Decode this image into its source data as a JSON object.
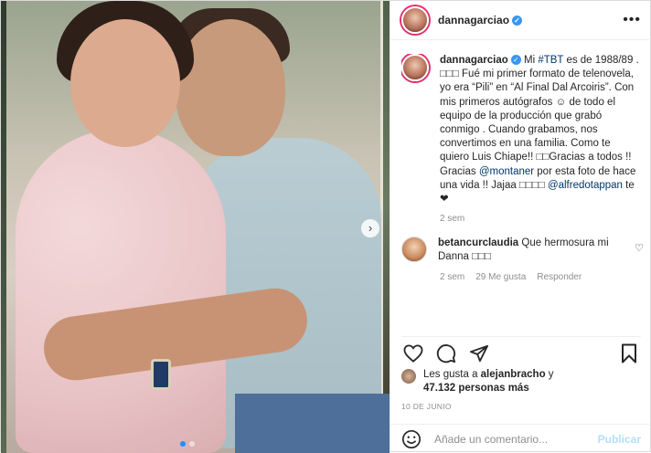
{
  "post": {
    "media": {
      "image_alt": "Foto antigua: niña abrazando a un hombre",
      "carousel_dots": 2,
      "active_dot": 0
    },
    "header": {
      "username": "dannagarciao",
      "more_glyph": "•••"
    },
    "caption": {
      "username": "dannagarciao",
      "parts": [
        {
          "type": "text",
          "value": "Mi "
        },
        {
          "type": "link",
          "value": "#TBT"
        },
        {
          "type": "text",
          "value": " es de 1988/89 . □□□ Fué mi primer formato de telenovela, yo era “Pili” en “Al Final Dal Arcoiris”. Con mis primeros autógrafos ☺ de todo el equipo de la producción que grabó conmigo . Cuando grabamos, nos convertimos en una familia. Como te quiero Luis Chiape!! □□Gracias a todos !! Gracias "
        },
        {
          "type": "link",
          "value": "@montaner"
        },
        {
          "type": "text",
          "value": " por esta foto de hace una vida !! Jajaa □□□□ "
        },
        {
          "type": "link",
          "value": "@alfredotappan"
        },
        {
          "type": "text",
          "value": " te❤"
        }
      ],
      "time": "2 sem"
    },
    "comment": {
      "username": "betancurclaudia",
      "text": "Que hermosura mi Danna □□□",
      "time": "2 sem",
      "likes": "29 Me gusta",
      "reply": "Responder"
    },
    "likes": {
      "prefix": "Les gusta a ",
      "user": "alejanbracho",
      "mid": " y",
      "count": "47.132 personas más"
    },
    "date": "10 DE JUNIO",
    "comment_box": {
      "placeholder": "Añade un comentario...",
      "publish_label": "Publicar"
    },
    "icons": {
      "like": "heart-icon",
      "comment": "comment-icon",
      "share": "share-icon",
      "save": "bookmark-icon",
      "emoji": "emoji-icon",
      "next": "chevron-right-icon",
      "verified": "verified-badge-icon"
    },
    "colors": {
      "verified": "#3897f0",
      "link": "#00376b",
      "publish_disabled": "#b2dffc",
      "meta": "#8e8e8e"
    }
  }
}
